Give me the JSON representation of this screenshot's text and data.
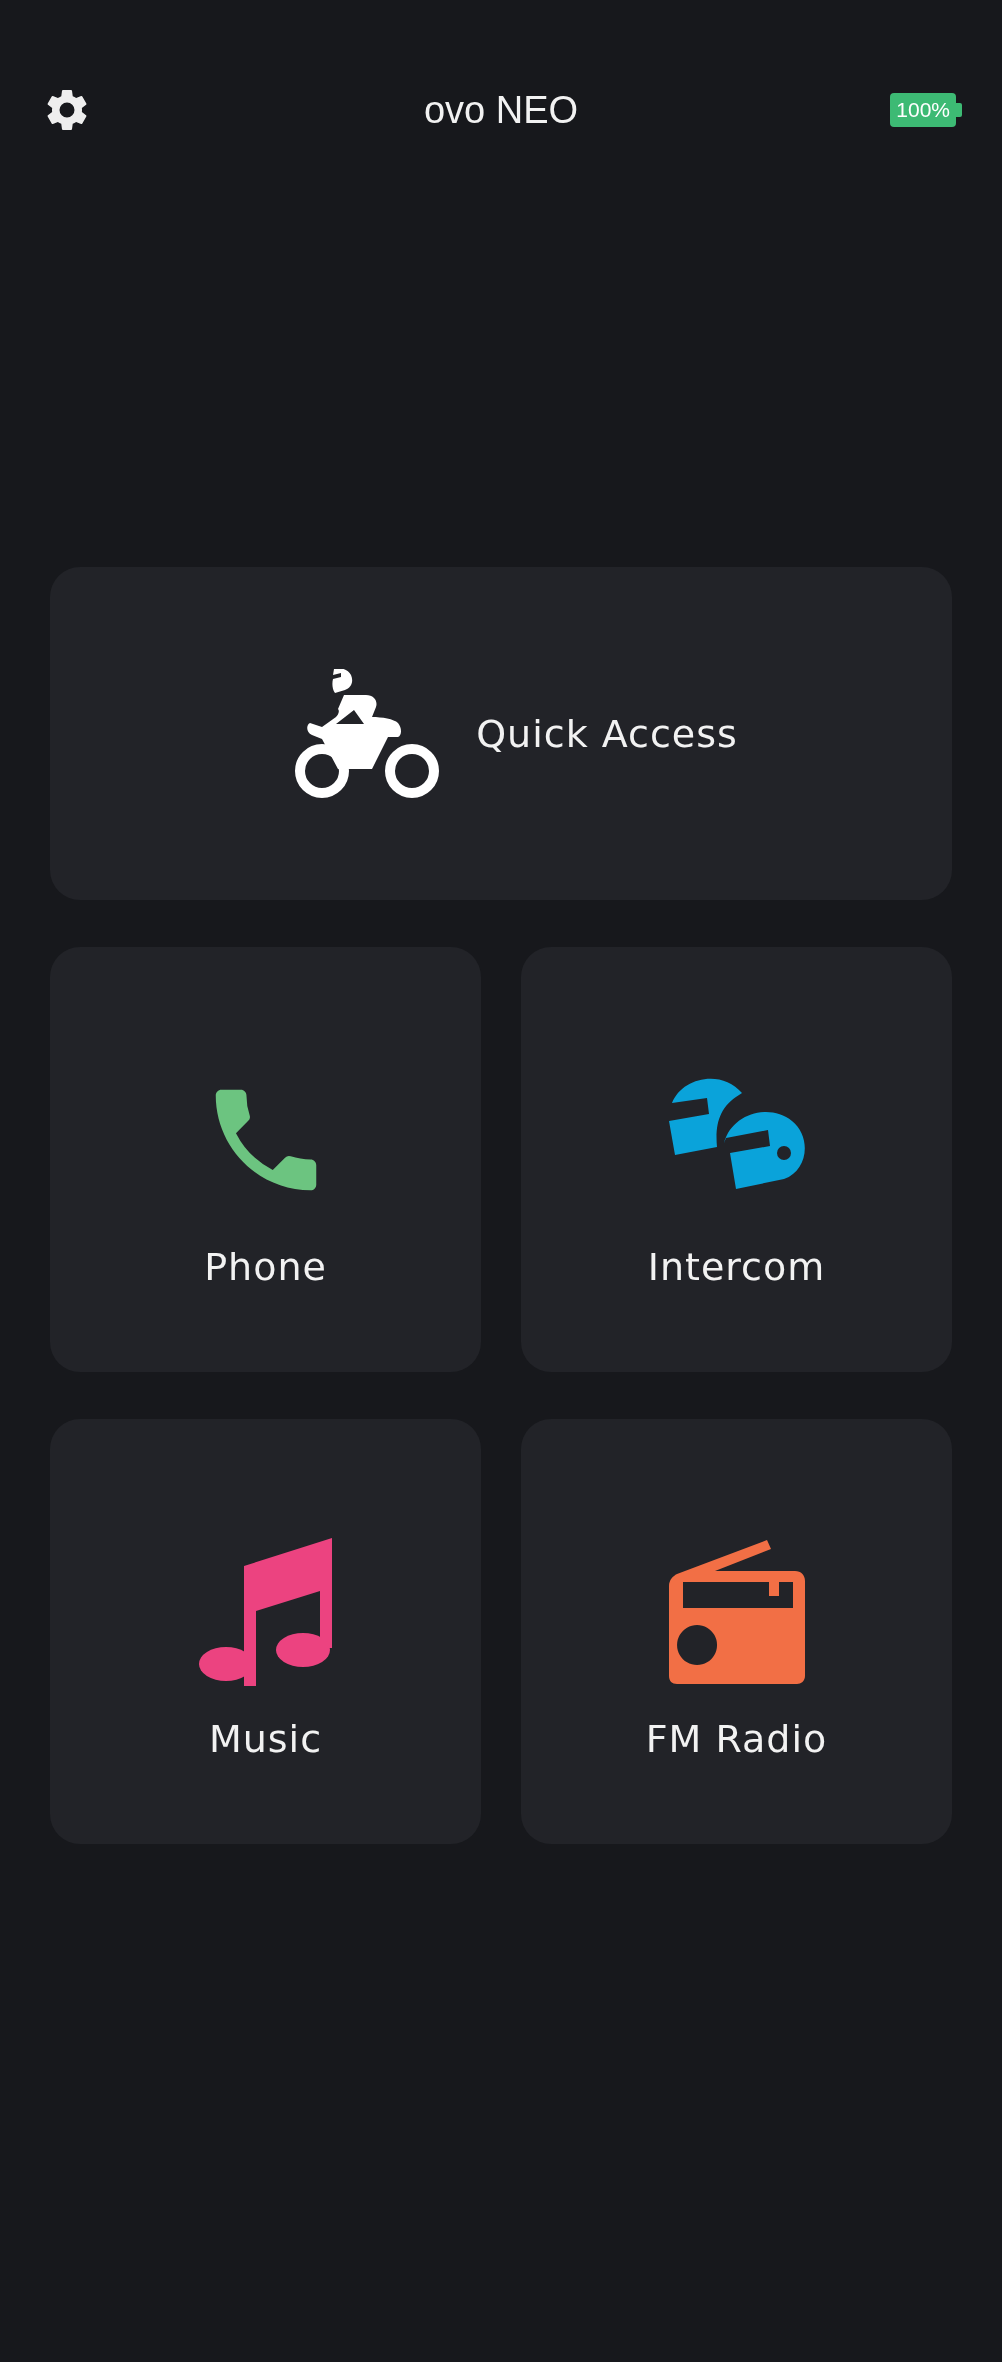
{
  "header": {
    "title": "ovo NEO",
    "battery": "100%"
  },
  "quick_access": {
    "label": "Quick Access"
  },
  "tiles": [
    {
      "kind": "phone",
      "label": "Phone",
      "color": "#6cc480"
    },
    {
      "kind": "intercom",
      "label": "Intercom",
      "color": "#0aa3da"
    },
    {
      "kind": "music",
      "label": "Music",
      "color": "#ec4380"
    },
    {
      "kind": "radio",
      "label": "FM Radio",
      "color": "#f26f45"
    }
  ]
}
